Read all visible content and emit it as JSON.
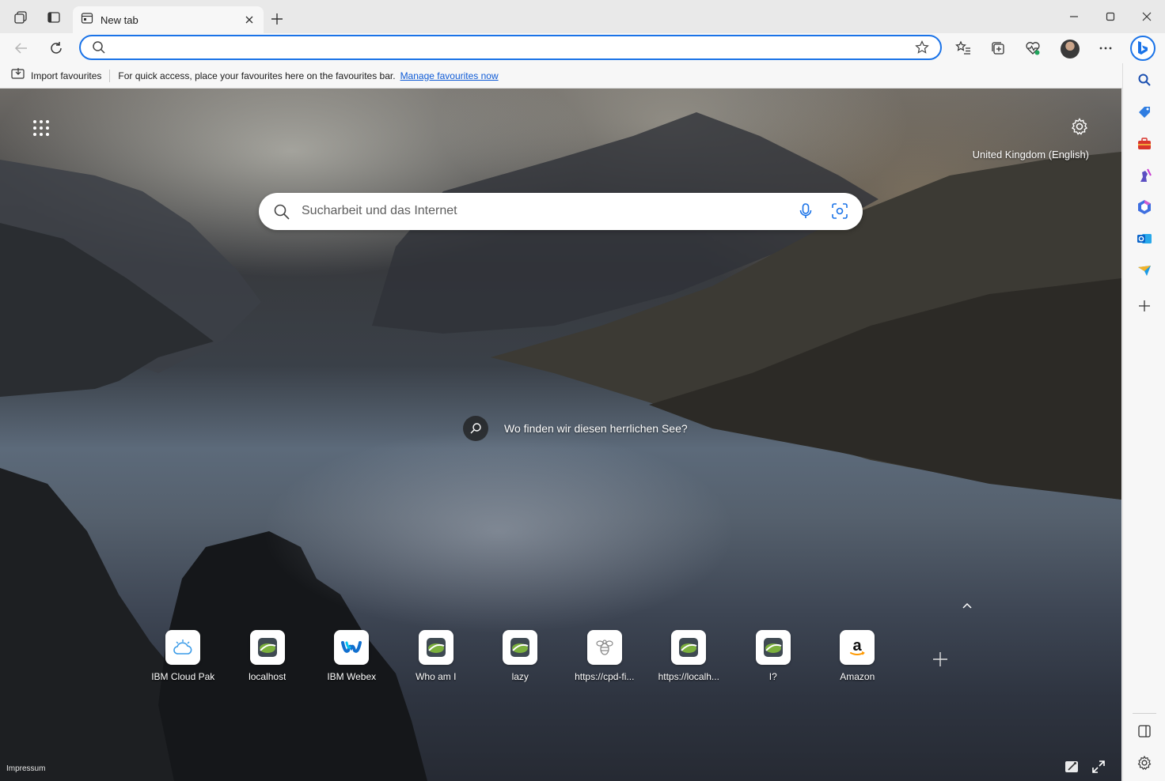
{
  "tab": {
    "title": "New tab",
    "icon": "newtab-page-icon"
  },
  "toolbar": {
    "address_value": "",
    "address_placeholder": ""
  },
  "favourites_bar": {
    "import_label": "Import favourites",
    "message": "For quick access, place your favourites here on the favourites bar.",
    "manage_link": "Manage favourites now"
  },
  "newtab": {
    "region": "United Kingdom (English)",
    "search_placeholder": "Sucharbeit und das Internet",
    "image_query": "Wo finden wir diesen herrlichen See?",
    "footer_link": "Impressum"
  },
  "quick_links": [
    {
      "label": "IBM Cloud Pak",
      "icon": "ibm-cloud-icon"
    },
    {
      "label": "localhost",
      "icon": "site-logo-icon"
    },
    {
      "label": "IBM Webex",
      "icon": "webex-icon"
    },
    {
      "label": "Who am I",
      "icon": "site-logo-icon"
    },
    {
      "label": "lazy",
      "icon": "site-logo-icon"
    },
    {
      "label": "https://cpd-fi...",
      "icon": "bee-icon"
    },
    {
      "label": "https://localh...",
      "icon": "site-logo-icon"
    },
    {
      "label": "I?",
      "icon": "site-logo-icon"
    },
    {
      "label": "Amazon",
      "icon": "amazon-icon"
    }
  ],
  "colors": {
    "accent": "#1a73e8",
    "link": "#0f5bd6"
  }
}
